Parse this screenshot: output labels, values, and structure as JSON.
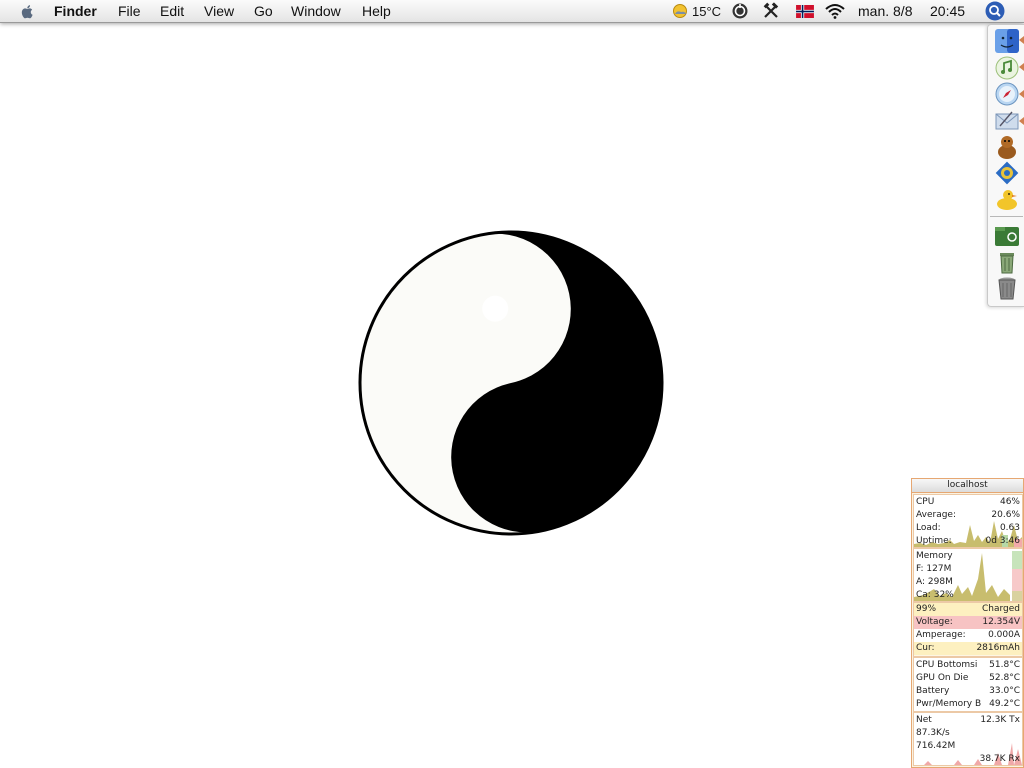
{
  "menubar": {
    "app_name": "Finder",
    "menus": [
      "File",
      "Edit",
      "View",
      "Go",
      "Window",
      "Help"
    ],
    "weather_temp": "15°C",
    "clock_date": "man. 8/8",
    "clock_time": "20:45",
    "icons": [
      "apple-icon",
      "weather-icon",
      "activity-monitor-icon",
      "tools-icon",
      "norway-flag-icon",
      "wifi-icon",
      "spotlight-icon"
    ]
  },
  "desktop": {
    "colors": {
      "background": "#ffffff",
      "yin": "#000000",
      "yang": "#fbfbf8"
    }
  },
  "dock": {
    "items": [
      "finder-icon",
      "itunes-icon",
      "safari-icon",
      "mail-icon",
      "adium-icon",
      "trillian-icon",
      "cyberduck-icon",
      "documents-folder-icon",
      "recycle-bin-icon",
      "trash-icon"
    ]
  },
  "monitor": {
    "title": "localhost",
    "cpu": {
      "label": "CPU",
      "value": "46%",
      "average_label": "Average:",
      "average": "20.6%",
      "load_label": "Load:",
      "load": "0.63",
      "uptime_label": "Uptime:",
      "uptime": "0d 3:46"
    },
    "memory": {
      "label": "Memory",
      "free_label": "F:",
      "free": "127M",
      "active_label": "A:",
      "active": "298M",
      "cache_label": "Ca:",
      "cache": "32%"
    },
    "battery": {
      "percent": "99%",
      "status": "Charged",
      "voltage_label": "Voltage:",
      "voltage": "12.354V",
      "amperage_label": "Amperage:",
      "amperage": "0.000A",
      "current_label": "Cur:",
      "current": "2816mAh"
    },
    "temperature": {
      "rows": [
        {
          "label": "CPU Bottomsi",
          "value": "51.8°C"
        },
        {
          "label": "GPU On Die",
          "value": "52.8°C"
        },
        {
          "label": "Battery",
          "value": "33.0°C"
        },
        {
          "label": "Pwr/Memory B",
          "value": "49.2°C"
        }
      ]
    },
    "network": {
      "label": "Net",
      "tx": "12.3K Tx",
      "rate": "87.3K/s",
      "total": "716.42M",
      "rx": "38.7K Rx"
    },
    "colors": {
      "border": "#e6a772",
      "graph": "#c8bd6e",
      "net_graph": "#f0a8a8",
      "voltage_bg": "#f7c3c3",
      "battery_bg": "#fdf0c0"
    }
  }
}
